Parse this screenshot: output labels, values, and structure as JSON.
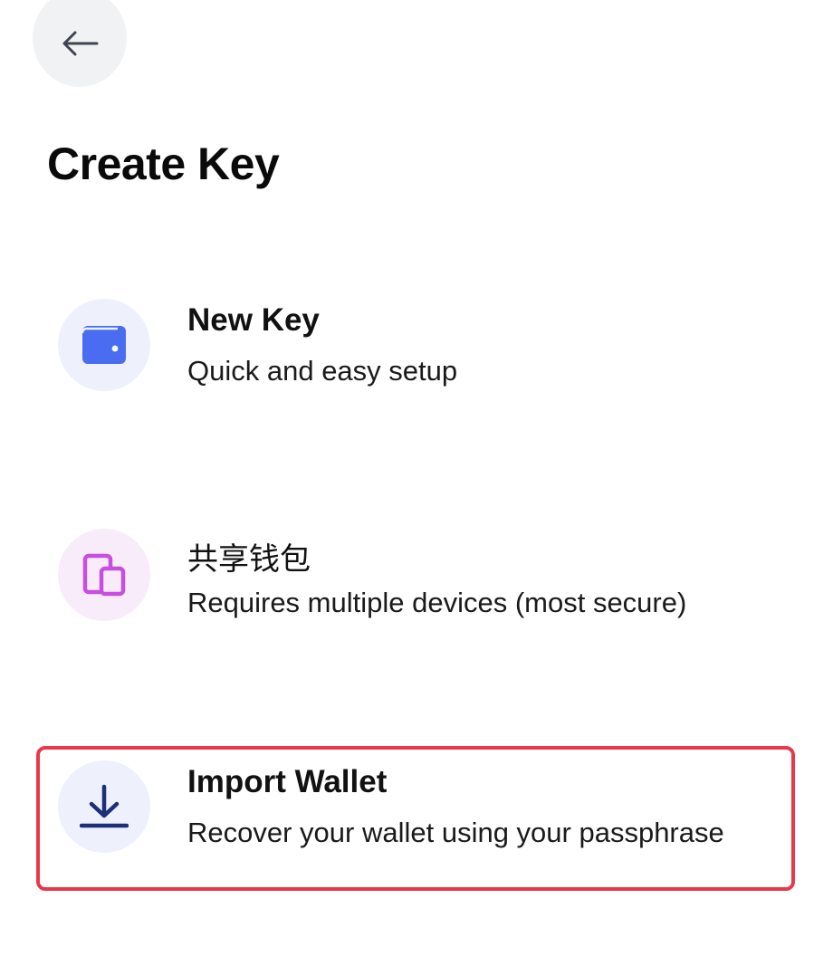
{
  "header": {
    "back_icon": "arrow-left-icon",
    "title": "Create Key"
  },
  "options": [
    {
      "id": "new-key",
      "icon": "wallet-icon",
      "icon_color": "#4a6cf0",
      "icon_bg": "#eef1fb",
      "title": "New Key",
      "subtitle": "Quick and easy setup"
    },
    {
      "id": "shared-wallet",
      "icon": "devices-icon",
      "icon_color": "#c64fdf",
      "icon_bg": "#f8ecfa",
      "title": "共享钱包",
      "subtitle": "Requires multiple devices (most secure)"
    },
    {
      "id": "import-wallet",
      "icon": "download-icon",
      "icon_color": "#1e2f7a",
      "icon_bg": "#eef1fb",
      "title": "Import Wallet",
      "subtitle": "Recover your wallet using your passphrase",
      "highlighted": true,
      "highlight_color": "#e8394a"
    }
  ]
}
